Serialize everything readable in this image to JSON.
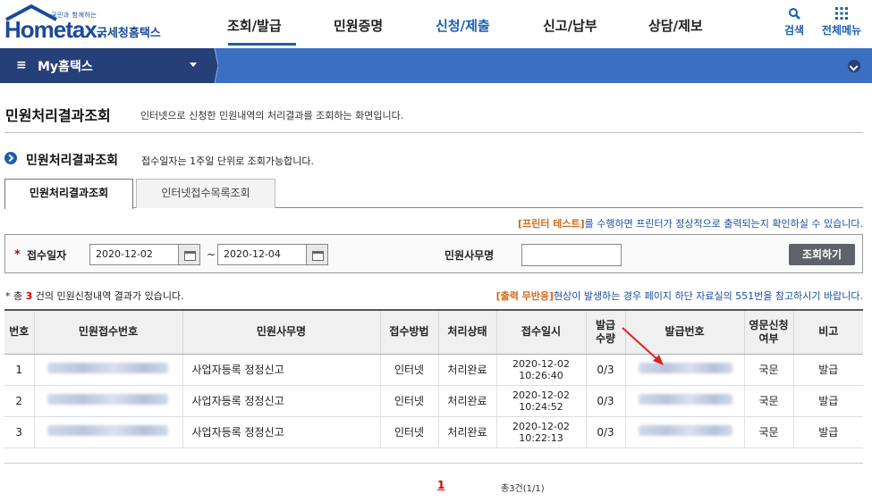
{
  "header": {
    "logo_small": "국민과 함께하는",
    "logo_word": "Hometax.",
    "logo_kor": "국세청홈택스",
    "nav": [
      "조회/발급",
      "민원증명",
      "신청/제출",
      "신고/납부",
      "상담/제보"
    ],
    "active_nav": "신청/제출",
    "search_label": "검색",
    "allmenu_label": "전체메뉴",
    "brand_color": "#1a4a9c",
    "accent_color": "#1a5fb0"
  },
  "mybar": {
    "title": "My홈택스",
    "menu_icon": "hamburger-icon"
  },
  "page": {
    "title": "민원처리결과조회",
    "desc": "인터넷으로 신청한 민원내역의 처리결과를 조회하는 화면입니다.",
    "section_title": "민원처리결과조회",
    "section_desc": "접수일자는 1주일 단위로 조회가능합니다."
  },
  "tabs": [
    {
      "label": "민원처리결과조회",
      "active": true
    },
    {
      "label": "인터넷접수목록조회",
      "active": false
    }
  ],
  "notice_printer": {
    "highlight": "[프린터 테스트]",
    "text": "를 수행하면 프린터가 정상적으로 출력되는지 확인하실 수 있습니다."
  },
  "search": {
    "date_label": "접수일자",
    "date_from": "2020-12-02",
    "date_to": "2020-12-04",
    "tilde": "~",
    "office_label": "민원사무명",
    "office_value": "",
    "button": "조회하기"
  },
  "result": {
    "count_prefix": "* 총",
    "count": "3",
    "count_suffix": "건의 민원신청내역 결과가 있습니다.",
    "notice_highlight": "[출력 무반응]",
    "notice_text": "현상이 발생하는 경우 페이지 하단 자료실의 551번을 참고하시기 바랍니다."
  },
  "table": {
    "headers": {
      "no": "번호",
      "receipt_no": "민원접수번호",
      "office": "민원사무명",
      "method": "접수방법",
      "status": "처리상태",
      "received_at": "접수일시",
      "qty_1": "발급",
      "qty_2": "수량",
      "issue_no": "발급번호",
      "eng_1": "영문신청",
      "eng_2": "여부",
      "remark": "비고"
    },
    "rows": [
      {
        "no": "1",
        "office": "사업자등록 정정신고",
        "method": "인터넷",
        "status": "처리완료",
        "date": "2020-12-02",
        "time": "10:26:40",
        "qty": "0/3",
        "eng": "국문",
        "remark": "발급"
      },
      {
        "no": "2",
        "office": "사업자등록 정정신고",
        "method": "인터넷",
        "status": "처리완료",
        "date": "2020-12-02",
        "time": "10:24:52",
        "qty": "0/3",
        "eng": "국문",
        "remark": "발급"
      },
      {
        "no": "3",
        "office": "사업자등록 정정신고",
        "method": "인터넷",
        "status": "처리완료",
        "date": "2020-12-02",
        "time": "10:22:13",
        "qty": "0/3",
        "eng": "국문",
        "remark": "발급"
      }
    ]
  },
  "pagination": {
    "current": "1",
    "total": "총3건(1/1)"
  }
}
